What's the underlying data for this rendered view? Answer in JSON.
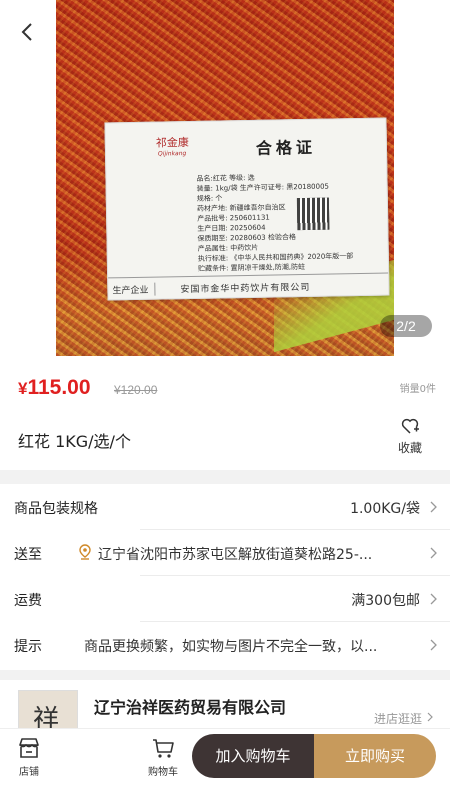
{
  "gallery": {
    "counter": "2/2",
    "certificate": {
      "brand": "祁金康",
      "brand_sub": "Qijinkang",
      "title": "合格证",
      "lines": [
        "品名:红花         等级: 选",
        "装量: 1kg/袋    生产许可证号: 黑20180005",
        "规格: 个",
        "药材产地: 新疆维吾尔自治区",
        "产品批号: 250601131",
        "生产日期: 20250604",
        "保质期至: 20280603     检验合格",
        "产品属性: 中药饮片",
        "执行标准: 《中华人民共和国药典》2020年版一部",
        "贮藏条件: 置阴凉干燥处,防潮,防蛀"
      ],
      "footer_label": "生产企业",
      "footer_value": "安国市金华中药饮片有限公司"
    }
  },
  "product": {
    "currency": "¥",
    "price": "115.00",
    "original_price": "¥120.00",
    "sales": "销量0件",
    "title": "红花 1KG/选/个",
    "favorite_label": "收藏"
  },
  "info_rows": {
    "spec": {
      "label": "商品包装规格",
      "value": "1.00KG/袋"
    },
    "ship_to": {
      "label": "送至",
      "value": "辽宁省沈阳市苏家屯区解放街道葵松路25-..."
    },
    "shipping": {
      "label": "运费",
      "value": "满300包邮"
    },
    "tips": {
      "label": "提示",
      "value": "商品更换频繁，如实物与图片不完全一致，以..."
    }
  },
  "shop": {
    "logo_char": "祥",
    "name": "辽宁治祥医药贸易有限公司",
    "link": "进店逛逛"
  },
  "bottom_bar": {
    "store_label": "店铺",
    "cart_label": "购物车",
    "add_to_cart": "加入购物车",
    "buy_now": "立即购买"
  },
  "colors": {
    "price_red": "#e02020",
    "cart_button": "#3e3434",
    "buy_button": "#c79a5c"
  }
}
